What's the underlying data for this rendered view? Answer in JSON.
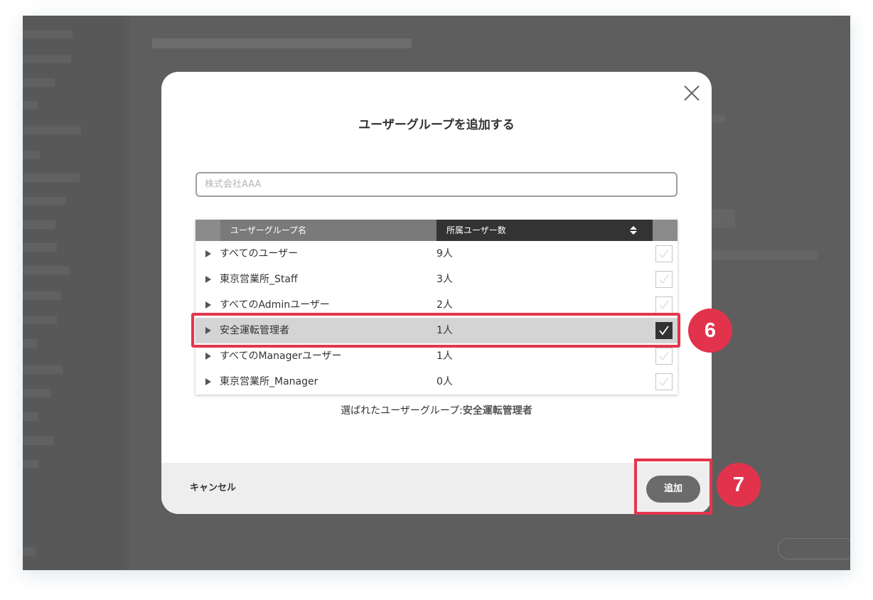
{
  "modal": {
    "title": "ユーザーグループを追加する",
    "search_placeholder": "株式会社AAA",
    "columns": {
      "name": "ユーザーグループ名",
      "count": "所属ユーザー数"
    },
    "rows": [
      {
        "name": "すべてのユーザー",
        "count": "9人",
        "checked": false
      },
      {
        "name": "東京営業所_Staff",
        "count": "3人",
        "checked": false
      },
      {
        "name": "すべてのAdminユーザー",
        "count": "2人",
        "checked": false
      },
      {
        "name": "安全運転管理者",
        "count": "1人",
        "checked": true
      },
      {
        "name": "すべてのManagerユーザー",
        "count": "1人",
        "checked": false
      },
      {
        "name": "東京営業所_Manager",
        "count": "0人",
        "checked": false
      }
    ],
    "selected_label": "選ばれたユーザーグループ:",
    "selected_value": "安全運転管理者",
    "cancel_label": "キャンセル",
    "add_label": "追加"
  },
  "annotations": {
    "step_a": "6",
    "step_b": "7",
    "highlight_color": "#e4354d"
  },
  "colors": {
    "overlay": "#5a5a5a",
    "header_sorted": "#333333",
    "selected_row": "#d4d4d4"
  }
}
